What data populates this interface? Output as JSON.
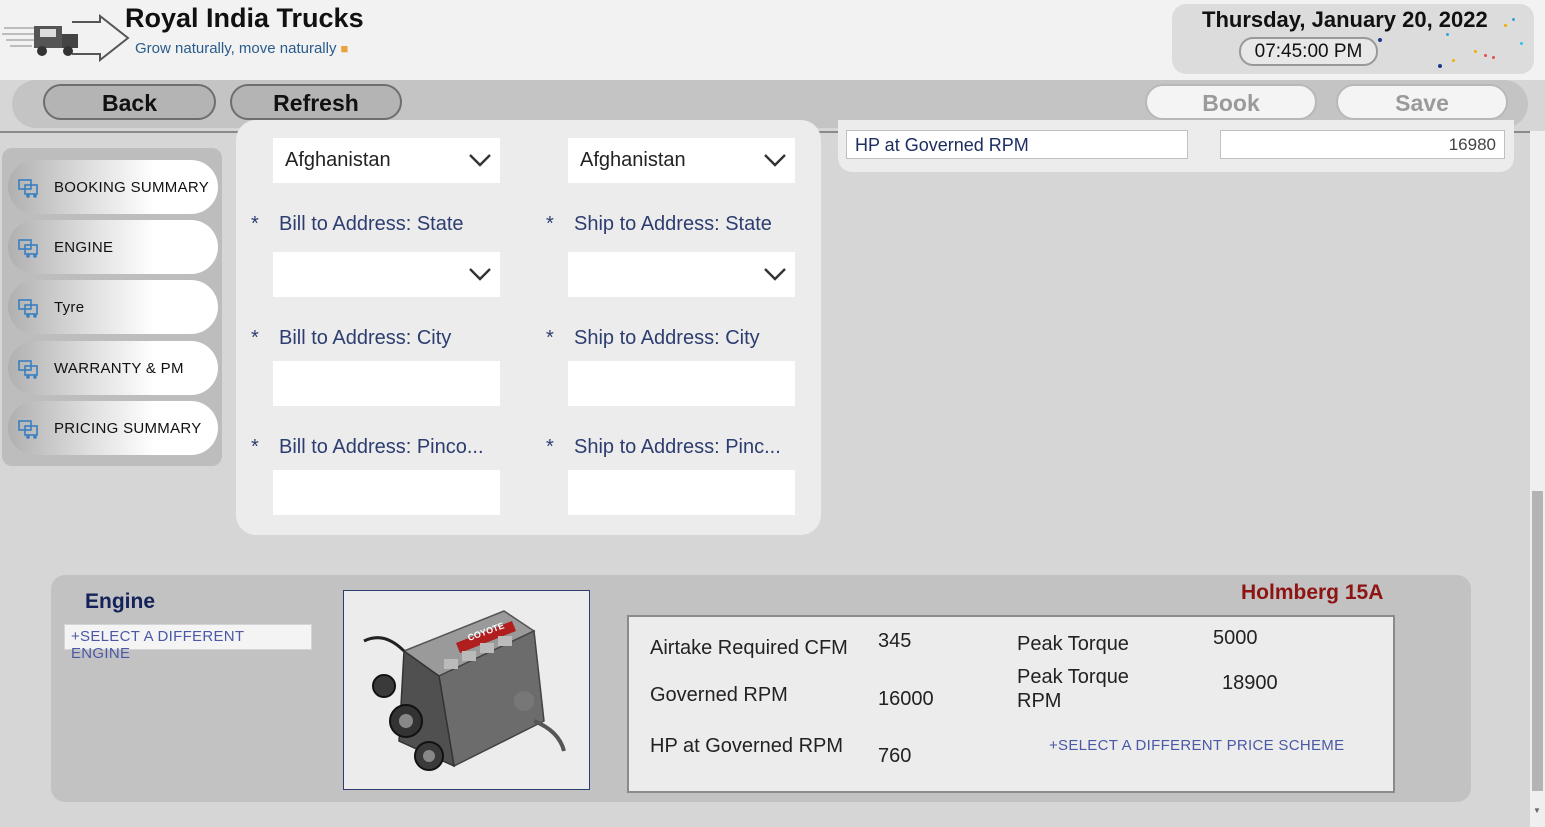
{
  "header": {
    "app_title": "Royal India Trucks",
    "tagline": "Grow naturally, move naturally",
    "tagline_icon": "delivery-truck-emoji",
    "date": "Thursday, January 20, 2022",
    "time": "07:45:00 PM"
  },
  "toolbar": {
    "back_label": "Back",
    "refresh_label": "Refresh",
    "book_label": "Book",
    "save_label": "Save"
  },
  "sidebar": {
    "items": [
      {
        "label": "BOOKING SUMMARY",
        "icon": "trucks-icon"
      },
      {
        "label": "ENGINE",
        "icon": "trucks-icon"
      },
      {
        "label": "Tyre",
        "icon": "trucks-icon"
      },
      {
        "label": "WARRANTY & PM",
        "icon": "trucks-icon"
      },
      {
        "label": "PRICING SUMMARY",
        "icon": "trucks-icon"
      }
    ]
  },
  "address": {
    "bill_country": "Afghanistan",
    "ship_country": "Afghanistan",
    "required_marker": "*",
    "bill_state_label": "Bill to Address:  State",
    "ship_state_label": "Ship to Address:  State",
    "bill_state_value": "",
    "ship_state_value": "",
    "bill_city_label": "Bill to Address:  City",
    "ship_city_label": "Ship to Address:  City",
    "bill_city_value": "",
    "ship_city_value": "",
    "bill_pin_label": "Bill to Address:  Pinco...",
    "ship_pin_label": "Ship to Address:  Pinc...",
    "bill_pin_value": "",
    "ship_pin_value": ""
  },
  "hp_row": {
    "label": "HP at Governed RPM",
    "value": "16980"
  },
  "engine": {
    "title": "Engine",
    "select_link": "+SELECT A DIFFERENT ENGINE",
    "image_brand_text": "COYOTE",
    "model": "Holmberg 15A",
    "specs": {
      "airtake_label": "Airtake Required CFM",
      "airtake_value": "345",
      "governed_rpm_label": "Governed RPM",
      "governed_rpm_value": "16000",
      "hp_label": "HP at Governed RPM",
      "hp_value": "760",
      "peak_torque_label": "Peak Torque",
      "peak_torque_value": "5000",
      "peak_torque_rpm_label": "Peak Torque RPM",
      "peak_torque_rpm_value": "18900"
    },
    "price_scheme_link": "+SELECT A DIFFERENT PRICE SCHEME"
  },
  "colors": {
    "accent_navy": "#2d3d70",
    "model_red": "#8e1414",
    "link_blue": "#4a58a6"
  }
}
